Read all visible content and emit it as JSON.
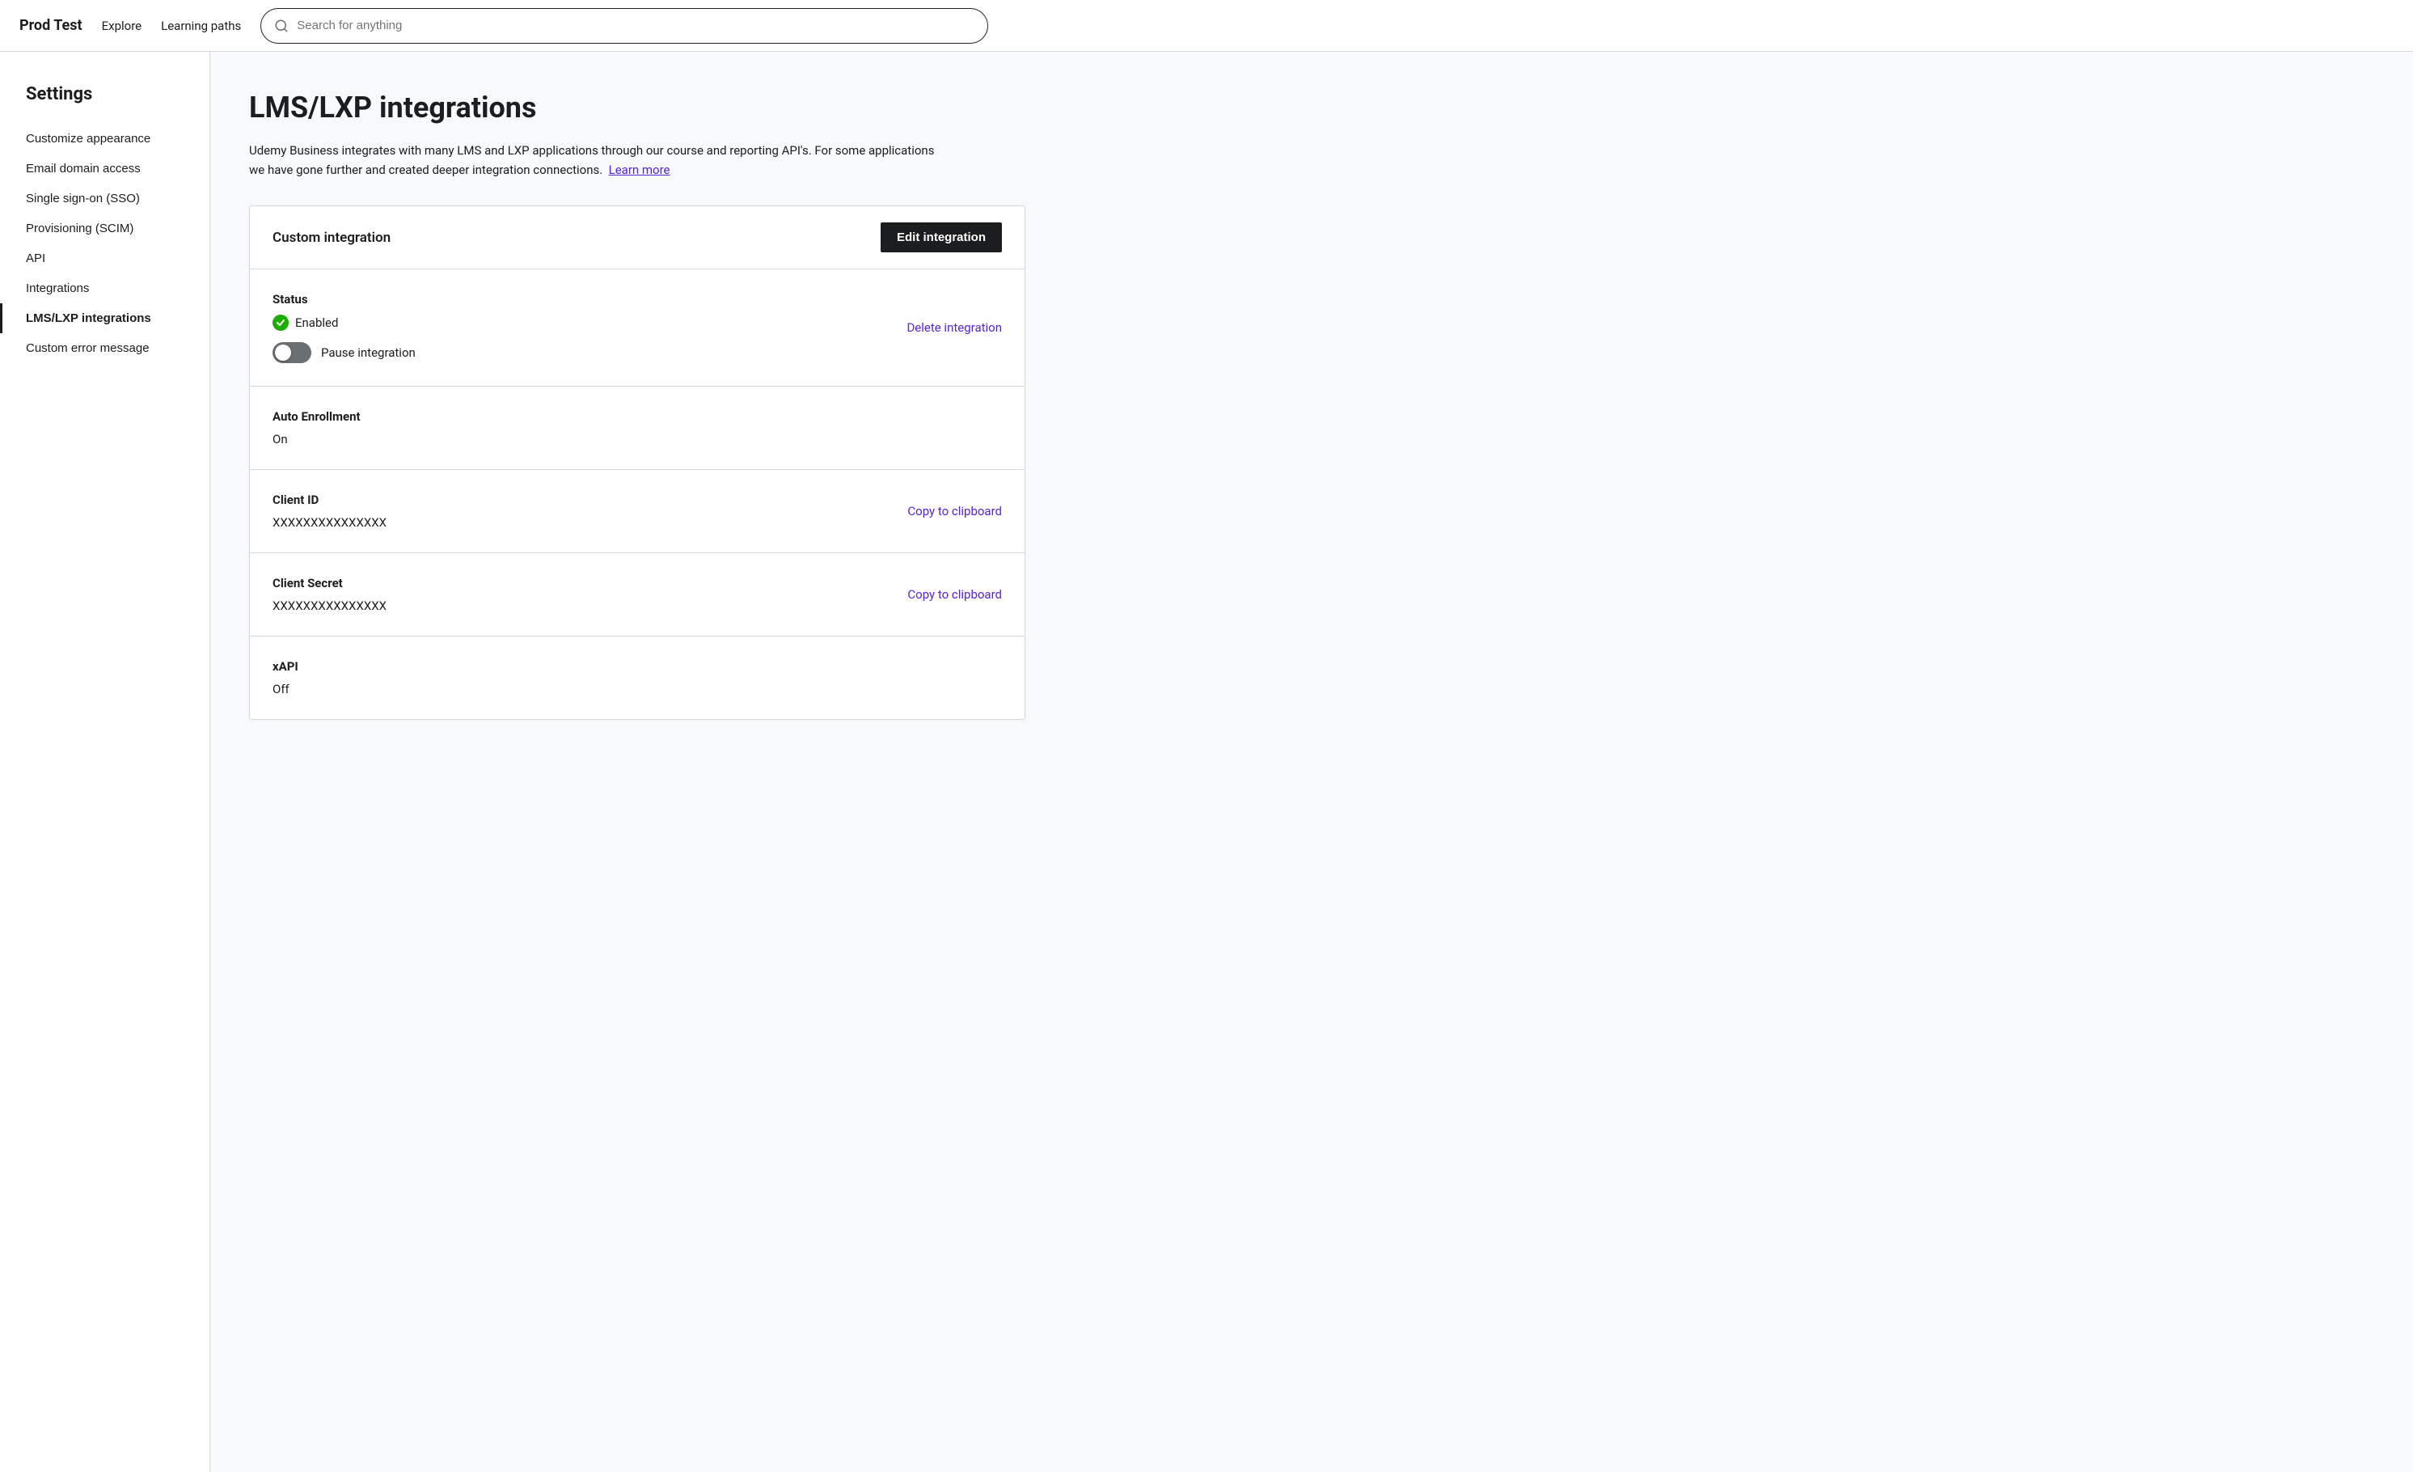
{
  "topnav": {
    "brand": "Prod Test",
    "links": [
      "Explore",
      "Learning paths"
    ],
    "search_placeholder": "Search for anything"
  },
  "sidebar": {
    "title": "Settings",
    "items": [
      {
        "id": "customize-appearance",
        "label": "Customize appearance",
        "active": false
      },
      {
        "id": "email-domain-access",
        "label": "Email domain access",
        "active": false
      },
      {
        "id": "single-sign-on",
        "label": "Single sign-on (SSO)",
        "active": false
      },
      {
        "id": "provisioning-scim",
        "label": "Provisioning (SCIM)",
        "active": false
      },
      {
        "id": "api",
        "label": "API",
        "active": false
      },
      {
        "id": "integrations",
        "label": "Integrations",
        "active": false
      },
      {
        "id": "lms-lxp-integrations",
        "label": "LMS/LXP integrations",
        "active": true
      },
      {
        "id": "custom-error-message",
        "label": "Custom error message",
        "active": false
      }
    ]
  },
  "main": {
    "page_title": "LMS/LXP integrations",
    "page_desc": "Udemy Business integrates with many LMS and LXP applications through our course and reporting API's. For some applications we have gone further and created deeper integration connections.",
    "learn_more_link": "Learn more",
    "card": {
      "header_title": "Custom integration",
      "edit_button_label": "Edit integration",
      "sections": [
        {
          "id": "status",
          "label": "Status",
          "status_text": "Enabled",
          "toggle_label": "Pause integration",
          "delete_link": "Delete integration"
        },
        {
          "id": "auto-enrollment",
          "label": "Auto Enrollment",
          "value": "On"
        },
        {
          "id": "client-id",
          "label": "Client ID",
          "value": "XXXXXXXXXXXXXXX",
          "copy_link": "Copy to clipboard"
        },
        {
          "id": "client-secret",
          "label": "Client Secret",
          "value": "XXXXXXXXXXXXXXX",
          "copy_link": "Copy to clipboard"
        },
        {
          "id": "xapi",
          "label": "xAPI",
          "value": "Off"
        }
      ]
    }
  }
}
